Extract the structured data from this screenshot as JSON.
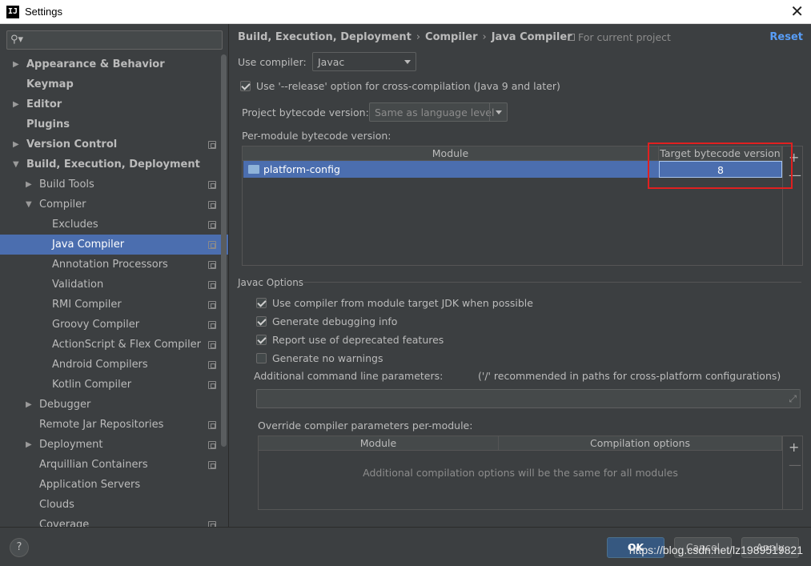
{
  "window": {
    "title": "Settings",
    "app_icon": "IJ",
    "close_glyph": "✕"
  },
  "sidebar": {
    "search_placeholder": "",
    "items": [
      {
        "label": "Appearance & Behavior",
        "level": 0,
        "arrow": "▶",
        "bold": true,
        "project": false
      },
      {
        "label": "Keymap",
        "level": 0,
        "arrow": "",
        "bold": true,
        "project": false
      },
      {
        "label": "Editor",
        "level": 0,
        "arrow": "▶",
        "bold": true,
        "project": false
      },
      {
        "label": "Plugins",
        "level": 0,
        "arrow": "",
        "bold": true,
        "project": false
      },
      {
        "label": "Version Control",
        "level": 0,
        "arrow": "▶",
        "bold": true,
        "project": true
      },
      {
        "label": "Build, Execution, Deployment",
        "level": 0,
        "arrow": "▼",
        "bold": true,
        "project": false
      },
      {
        "label": "Build Tools",
        "level": 1,
        "arrow": "▶",
        "bold": false,
        "project": true
      },
      {
        "label": "Compiler",
        "level": 1,
        "arrow": "▼",
        "bold": false,
        "project": true
      },
      {
        "label": "Excludes",
        "level": 2,
        "arrow": "",
        "bold": false,
        "project": true
      },
      {
        "label": "Java Compiler",
        "level": 2,
        "arrow": "",
        "bold": false,
        "project": true,
        "selected": true
      },
      {
        "label": "Annotation Processors",
        "level": 2,
        "arrow": "",
        "bold": false,
        "project": true
      },
      {
        "label": "Validation",
        "level": 2,
        "arrow": "",
        "bold": false,
        "project": true
      },
      {
        "label": "RMI Compiler",
        "level": 2,
        "arrow": "",
        "bold": false,
        "project": true
      },
      {
        "label": "Groovy Compiler",
        "level": 2,
        "arrow": "",
        "bold": false,
        "project": true
      },
      {
        "label": "ActionScript & Flex Compiler",
        "level": 2,
        "arrow": "",
        "bold": false,
        "project": true
      },
      {
        "label": "Android Compilers",
        "level": 2,
        "arrow": "",
        "bold": false,
        "project": true
      },
      {
        "label": "Kotlin Compiler",
        "level": 2,
        "arrow": "",
        "bold": false,
        "project": true
      },
      {
        "label": "Debugger",
        "level": 1,
        "arrow": "▶",
        "bold": false,
        "project": false
      },
      {
        "label": "Remote Jar Repositories",
        "level": 1,
        "arrow": "",
        "bold": false,
        "project": true
      },
      {
        "label": "Deployment",
        "level": 1,
        "arrow": "▶",
        "bold": false,
        "project": true
      },
      {
        "label": "Arquillian Containers",
        "level": 1,
        "arrow": "",
        "bold": false,
        "project": true
      },
      {
        "label": "Application Servers",
        "level": 1,
        "arrow": "",
        "bold": false,
        "project": false
      },
      {
        "label": "Clouds",
        "level": 1,
        "arrow": "",
        "bold": false,
        "project": false
      },
      {
        "label": "Coverage",
        "level": 1,
        "arrow": "",
        "bold": false,
        "project": true
      }
    ]
  },
  "main": {
    "breadcrumb": [
      "Build, Execution, Deployment",
      "Compiler",
      "Java Compiler"
    ],
    "breadcrumb_sep": "›",
    "for_project": "For current project",
    "reset": "Reset",
    "use_compiler_label": "Use compiler:",
    "use_compiler_value": "Javac",
    "release_option": {
      "label": "Use '--release' option for cross-compilation (Java 9 and later)",
      "checked": true
    },
    "project_bytecode_label": "Project bytecode version:",
    "project_bytecode_value": "Same as language level",
    "per_module_label": "Per-module bytecode version:",
    "module_table": {
      "headers": [
        "Module",
        "Target bytecode version"
      ],
      "rows": [
        {
          "module": "platform-config",
          "version": "8"
        }
      ],
      "add": "+",
      "remove": "—"
    },
    "javac_options_title": "Javac Options",
    "javac_options": [
      {
        "label": "Use compiler from module target JDK when possible",
        "checked": true
      },
      {
        "label": "Generate debugging info",
        "checked": true
      },
      {
        "label": "Report use of deprecated features",
        "checked": true
      },
      {
        "label": "Generate no warnings",
        "checked": false
      }
    ],
    "additional_params_label": "Additional command line parameters:",
    "additional_params_hint": "('/' recommended in paths for cross-platform configurations)",
    "additional_params_value": "",
    "override_label": "Override compiler parameters per-module:",
    "override_table": {
      "headers": [
        "Module",
        "Compilation options"
      ],
      "empty_text": "Additional compilation options will be the same for all modules",
      "add": "+",
      "remove": "—"
    }
  },
  "footer": {
    "help": "?",
    "ok": "OK",
    "cancel": "Cancel",
    "apply": "Apply",
    "watermark": "https://blog.csdn.net/lz1989519821"
  },
  "colors": {
    "selection": "#4b6eaf",
    "accent_link": "#589df6",
    "highlight_box": "#e02020"
  }
}
